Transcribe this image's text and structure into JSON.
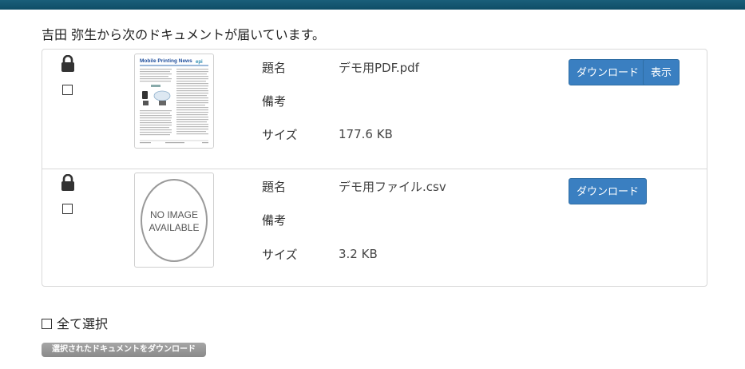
{
  "header": {
    "message": "吉田 弥生から次のドキュメントが届いています。"
  },
  "labels": {
    "title": "題名",
    "note": "備考",
    "size": "サイズ"
  },
  "documents": [
    {
      "title": "デモ用PDF.pdf",
      "note": "",
      "size": "177.6 KB",
      "download_label": "ダウンロード",
      "view_label": "表示",
      "thumb": {
        "heading": "Mobile Printing News",
        "logo": "epi"
      }
    },
    {
      "title": "デモ用ファイル.csv",
      "note": "",
      "size": "3.2 KB",
      "download_label": "ダウンロード",
      "thumb": {
        "line1": "NO IMAGE",
        "line2": "AVAILABLE"
      }
    }
  ],
  "footer": {
    "select_all_label": "全て選択",
    "download_selected_label": "選択されたドキュメントをダウンロード"
  },
  "colors": {
    "topbar": "#135a75",
    "button": "#3a7fc1"
  }
}
